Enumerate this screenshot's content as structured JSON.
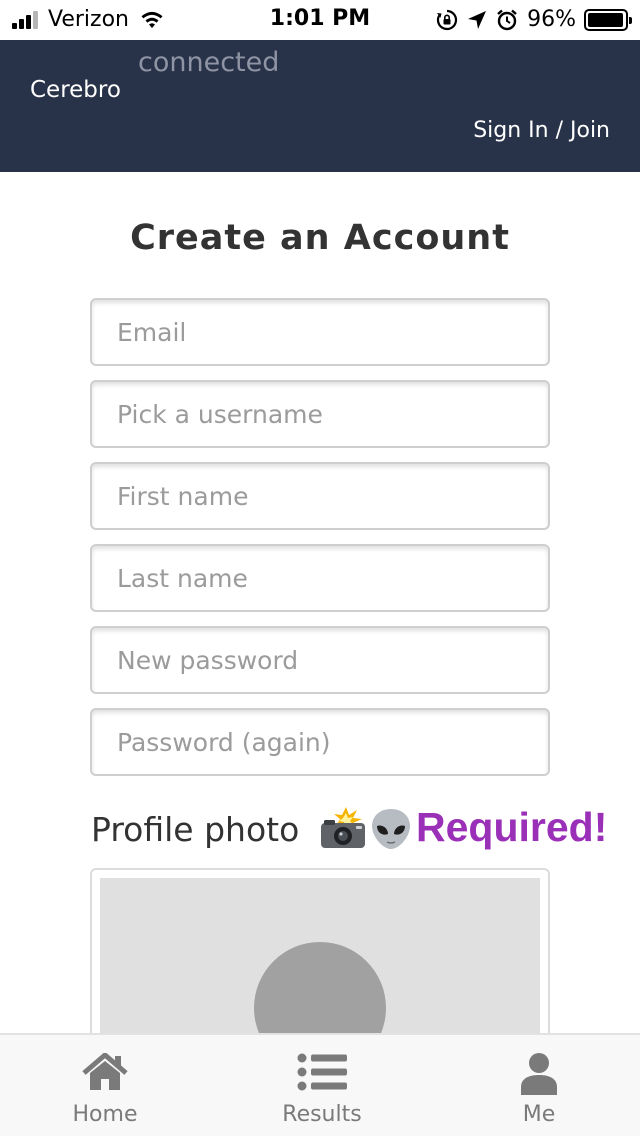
{
  "status_bar": {
    "carrier": "Verizon",
    "time": "1:01 PM",
    "battery": "96%",
    "battery_level": 0.96
  },
  "header": {
    "brand": "Cerebro",
    "connection_status": "connected",
    "sign_in_label": "Sign In / Join"
  },
  "form": {
    "title": "Create an Account",
    "fields": [
      {
        "placeholder": "Email",
        "value": ""
      },
      {
        "placeholder": "Pick a username",
        "value": ""
      },
      {
        "placeholder": "First name",
        "value": ""
      },
      {
        "placeholder": "Last name",
        "value": ""
      },
      {
        "placeholder": "New password",
        "value": ""
      },
      {
        "placeholder": "Password (again)",
        "value": ""
      }
    ],
    "profile_photo_label": "Profile photo",
    "required_label": "Required!"
  },
  "tabs": [
    {
      "label": "Home",
      "icon": "home-icon"
    },
    {
      "label": "Results",
      "icon": "list-icon"
    },
    {
      "label": "Me",
      "icon": "user-icon"
    }
  ],
  "colors": {
    "header_bg": "#283249",
    "required": "#9b30b8",
    "tab_icon": "#7a7a7a"
  }
}
